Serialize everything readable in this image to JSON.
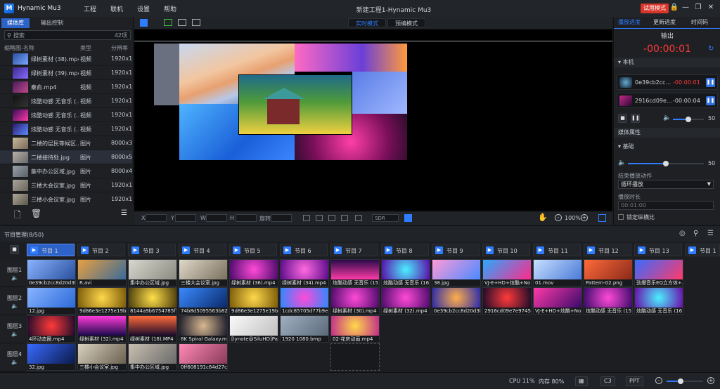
{
  "app": {
    "name": "Hynamic Mu3",
    "window_title": "新建工程1-Hynamic Mu3",
    "trial_label": "试用模式",
    "menus": [
      "工程",
      "联机",
      "设置",
      "帮助"
    ]
  },
  "media_panel": {
    "tabs": [
      "媒体库",
      "输出控制"
    ],
    "search_placeholder": "搜索",
    "count": "42项",
    "columns": [
      "缩略图-名称",
      "类型",
      "分辨率"
    ],
    "items": [
      {
        "name": "绿树素材 (38).mp4",
        "type": "视频",
        "res": "1920x1"
      },
      {
        "name": "绿树素材 (39).mp4",
        "type": "视频",
        "res": "1920x1"
      },
      {
        "name": "秦俞.mp4",
        "type": "视频",
        "res": "1920x1"
      },
      {
        "name": "炫酷动感 无音乐 (...",
        "type": "视频",
        "res": "1920x1"
      },
      {
        "name": "炫酷动感 无音乐 (...",
        "type": "视频",
        "res": "1920x1"
      },
      {
        "name": "炫酷动感 无音乐 (...",
        "type": "视频",
        "res": "1920x1"
      },
      {
        "name": "二楼的层民等候区...",
        "type": "图片",
        "res": "8000x3"
      },
      {
        "name": "二楼接待处.jpg",
        "type": "图片",
        "res": "8000x5"
      },
      {
        "name": "集中办公区域.jpg",
        "type": "图片",
        "res": "8000x4"
      },
      {
        "name": "三楼大会议室.jpg",
        "type": "图片",
        "res": "1920x1"
      },
      {
        "name": "三楼小会议室.jpg",
        "type": "图片",
        "res": "1920x1"
      }
    ]
  },
  "preview": {
    "modes": [
      "实时模式",
      "预编模式"
    ],
    "coord_labels": [
      "X",
      "Y",
      "W",
      "H",
      "旋转"
    ],
    "sdr": "SDR",
    "zoom": "100%"
  },
  "right_panel": {
    "tabs": [
      "播放进度",
      "更新进度",
      "时间码"
    ],
    "output_label": "输出",
    "output_time": "-00:00:01",
    "local_label": "本机",
    "players": [
      {
        "name": "0e39cb2cc...",
        "time": "-00:00:01"
      },
      {
        "name": "2916cd09e...",
        "time": "-00:00:04"
      }
    ],
    "volume": "50",
    "media_props": "媒体属性",
    "basic": "基础",
    "basic_volume": "50",
    "end_action_label": "结束播放动作",
    "end_action_value": "循环播放",
    "duration_label": "播放时长",
    "duration_value": "00:01:00",
    "lock_ratio": "锁定纵横比"
  },
  "program_manager": {
    "title": "节目管理(8/50)",
    "programs": [
      "节目 1",
      "节目 2",
      "节目 3",
      "节目 4",
      "节目 5",
      "节目 6",
      "节目 7",
      "节目 8",
      "节目 9",
      "节目 10",
      "节目 11",
      "节目 12",
      "节目 13",
      "节目 1"
    ],
    "layers": [
      "图层1",
      "图层2",
      "图层3",
      "图层4"
    ],
    "cells": [
      [
        "0e39cb2cc8d20d3f...",
        "R.avi",
        "集中办公区域.jpg",
        "三楼大会议室.jpg",
        "绿树素材 (36).mp4",
        "绿树素材 (34).mp4",
        "炫酷动感 无音乐 (15)...",
        "炫酷动感 无音乐 (16)...",
        "38.jpg",
        "VJ-E+HD+炫酷+No.13.mov",
        "01.mov",
        "Pattern-02.png",
        "劲爆音乐EQ立方体+..."
      ],
      [
        "12.jpg",
        "9d86e3e1275e19b6...",
        "8144a9b6754785f79...",
        "74b8d5095563b82b...",
        "9d86e3e1275e19b6...",
        "1cdc85705d77b9e1...",
        "绿树素材 (30).mp4",
        "绿树素材 (32).mp4",
        "0e39cb2cc8d20d3f...",
        "2916cd09e7e9745...",
        "VJ-E+HD+炫酷+No.14.mov",
        "炫酷动感 无音乐 (15)...",
        "炫酷动感 无音乐 (16)..."
      ],
      [
        "4环动态圈.mp4",
        "绿树素材 (32).mp4",
        "绿树素材 (18).MP4",
        "8K Spiral Galaxy.mp4",
        "[lynote@SiluHD]Pan...",
        "1920 1080.bmp",
        "02-花房动画.mp4"
      ],
      [
        "32.jpg",
        "三楼小会议室.jpg",
        "集中办公区域.jpg",
        "0ff608191c64d27c1..."
      ]
    ]
  },
  "status": {
    "cpu": "CPU 11%",
    "mem": "内存 80%",
    "c3": "C3",
    "ppt": "PPT"
  }
}
